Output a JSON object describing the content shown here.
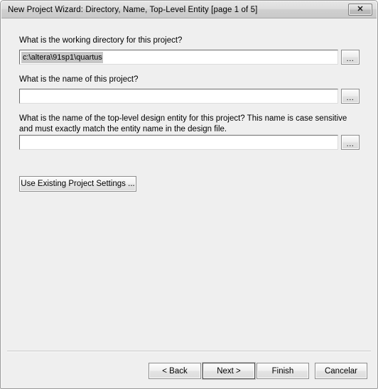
{
  "window": {
    "title": "New Project Wizard: Directory, Name, Top-Level Entity [page 1 of 5]",
    "close_glyph": "✕",
    "background_color": "#efefef",
    "titlebar_color": "#d4d4d4"
  },
  "form": {
    "working_directory": {
      "question": "What is the working directory for this project?",
      "value": "c:\\altera\\91sp1\\quartus",
      "placeholder": "",
      "selected": true,
      "browse_label": "..."
    },
    "project_name": {
      "question": "What is the name of this project?",
      "value": "",
      "placeholder": "",
      "browse_label": "..."
    },
    "top_level_entity": {
      "question": "What is the name of the top-level design entity for this project? This name is case sensitive and must exactly match the entity name in the design file.",
      "value": "",
      "placeholder": "",
      "browse_label": "..."
    },
    "use_existing_settings_label": "Use Existing Project Settings ..."
  },
  "footer": {
    "back_label": "< Back",
    "next_label": "Next >",
    "finish_label": "Finish",
    "cancel_label": "Cancelar"
  }
}
